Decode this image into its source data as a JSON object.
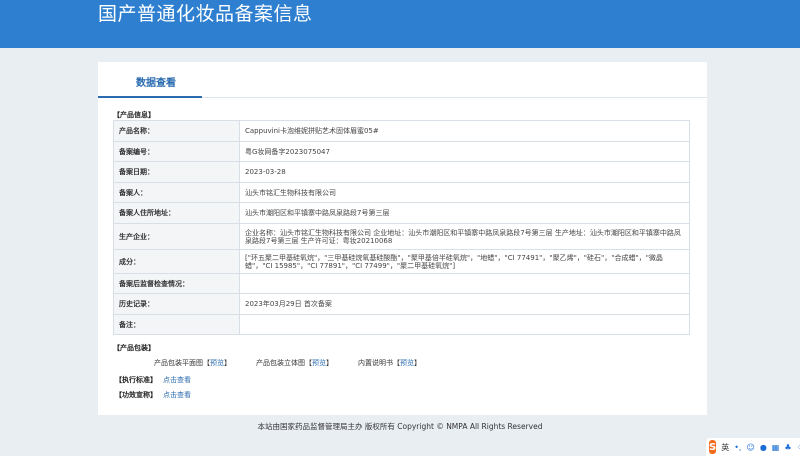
{
  "header": {
    "title": "国产普通化妆品备案信息"
  },
  "tabs": [
    {
      "label": "数据查看"
    }
  ],
  "product_info": {
    "section_label": "【产品信息】",
    "rows": [
      {
        "key": "产品名称：",
        "value": "Cappuvini卡泡维妮拼贴艺术固体眉蜜05#"
      },
      {
        "key": "备案编号：",
        "value": "粤G妆网备字2023075047"
      },
      {
        "key": "备案日期：",
        "value": "2023-03-28"
      },
      {
        "key": "备案人：",
        "value": "汕头市铭汇生物科技有限公司"
      },
      {
        "key": "备案人住所地址：",
        "value": "汕头市潮阳区和平镇寨中路凤泉路段7号第三层"
      },
      {
        "key": "生产企业：",
        "value": "企业名称：汕头市铭汇生物科技有限公司 企业地址：汕头市潮阳区和平镇寨中路凤泉路段7号第三层 生产地址：汕头市潮阳区和平镇寨中路凤泉路段7号第三层 生产许可证：粤妆20210068"
      },
      {
        "key": "成分：",
        "value": "[\"环五聚二甲基硅氧烷\"，\"三甲基硅烷氧基硅酸酯\"，\"聚甲基倍半硅氧烷\"，\"地蜡\"，\"CI 77491\"，\"聚乙烯\"，\"硅石\"，\"合成蜡\"，\"微晶蜡\"，\"CI 15985\"，\"CI 77891\"，\"CI 77499\"，\"聚二甲基硅氧烷\"]"
      },
      {
        "key": "备案后监督检查情况：",
        "value": ""
      },
      {
        "key": "历史记录：",
        "value": "2023年03月29日 首次备案"
      },
      {
        "key": "备注：",
        "value": ""
      }
    ]
  },
  "packaging": {
    "section_label": "【产品包装】",
    "items": [
      {
        "label": "产品包装平面图",
        "link": "预览"
      },
      {
        "label": "产品包装立体图",
        "link": "预览"
      },
      {
        "label": "内置说明书",
        "link": "预览"
      }
    ]
  },
  "standards": {
    "label": "【执行标准】",
    "link": "点击查看"
  },
  "efficacy": {
    "label": "【功效宣称】",
    "link": "点击查看"
  },
  "footer": {
    "text": "本站由国家药品监督管理局主办 版权所有 Copyright © NMPA All Rights Reserved"
  },
  "ime": {
    "mode": "英"
  }
}
